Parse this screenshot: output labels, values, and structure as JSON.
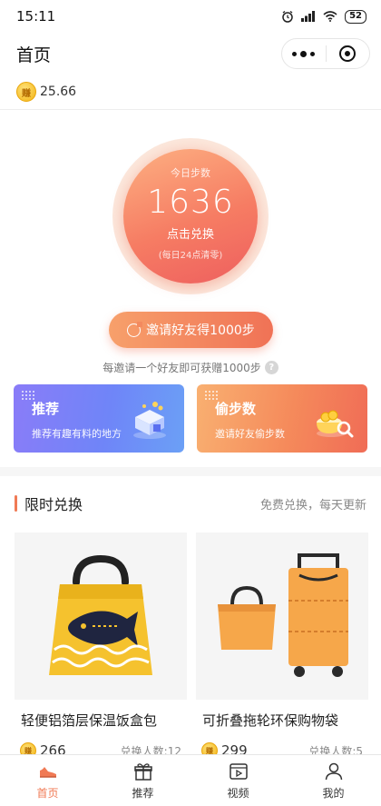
{
  "status_bar": {
    "time": "15:11",
    "battery": "52"
  },
  "nav": {
    "title": "首页"
  },
  "wallet": {
    "balance": "25.66",
    "coin_symbol": "赚"
  },
  "steps": {
    "label": "今日步数",
    "value": "1636",
    "action": "点击兑换",
    "note": "(每日24点清零)"
  },
  "invite": {
    "button_label": "邀请好友得1000步",
    "tip": "每邀请一个好友即可获赠1000步",
    "help": "?"
  },
  "cards": {
    "recommend": {
      "title": "推荐",
      "subtitle": "推荐有趣有料的地方"
    },
    "steal": {
      "title": "偷步数",
      "subtitle": "邀请好友偷步数"
    }
  },
  "limited": {
    "title": "限时兑换",
    "subtitle": "免费兑换，每天更新",
    "products": [
      {
        "name": "轻便铝箔层保温饭盒包",
        "price": "266",
        "exchanged": "兑换人数:12"
      },
      {
        "name": "可折叠拖轮环保购物袋",
        "price": "299",
        "exchanged": "兑换人数:5"
      }
    ]
  },
  "tabs": [
    {
      "label": "首页",
      "icon": "shoe-icon"
    },
    {
      "label": "推荐",
      "icon": "gift-icon"
    },
    {
      "label": "视频",
      "icon": "video-icon"
    },
    {
      "label": "我的",
      "icon": "user-icon"
    }
  ],
  "colors": {
    "accent": "#f07a55",
    "card_blue": "#7b83f7",
    "card_orange": "#f58a5b"
  }
}
